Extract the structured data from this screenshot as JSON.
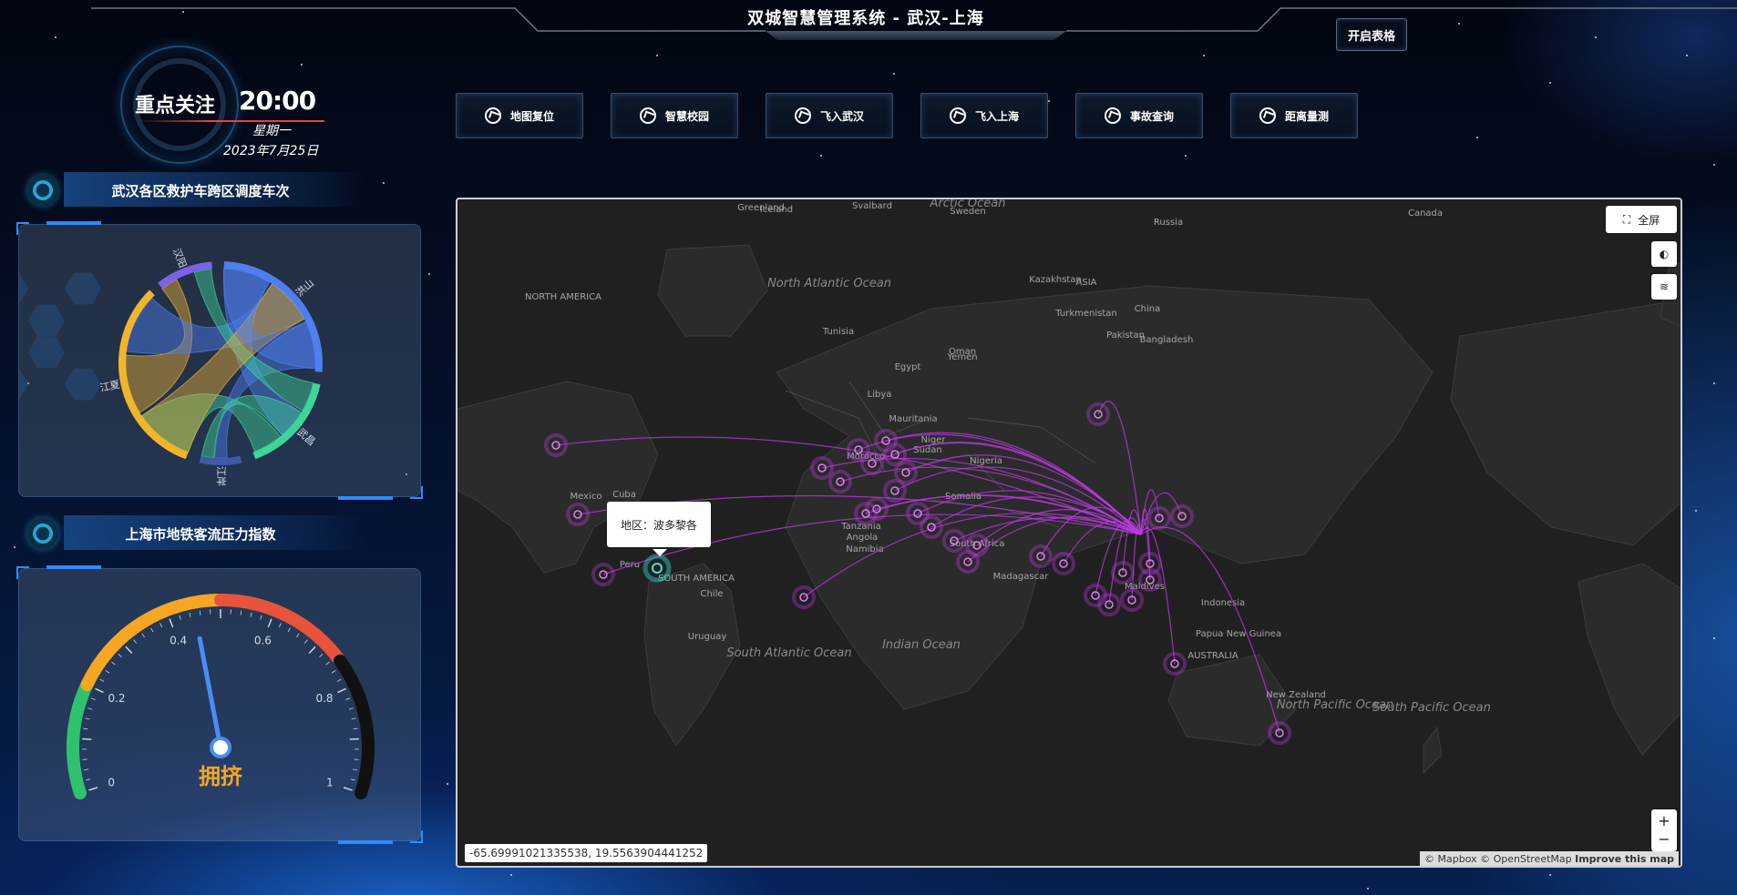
{
  "header": {
    "title": "双城智慧管理系统 - 武汉-上海",
    "toggle_table_label": "开启表格"
  },
  "clock": {
    "focus_label": "重点关注",
    "time": "20:00",
    "weekday": "星期一",
    "date": "2023年7月25日"
  },
  "nav": [
    {
      "label": "地图复位",
      "icon": "map-reset-icon"
    },
    {
      "label": "智慧校园",
      "icon": "campus-icon"
    },
    {
      "label": "飞入武汉",
      "icon": "plane-icon"
    },
    {
      "label": "飞入上海",
      "icon": "plane-icon"
    },
    {
      "label": "事故查询",
      "icon": "incident-icon"
    },
    {
      "label": "距离量测",
      "icon": "measure-icon"
    }
  ],
  "chord_section": {
    "title": "武汉各区救护车跨区调度车次",
    "groups": [
      {
        "name": "汉阳",
        "color": "#7a63e8"
      },
      {
        "name": "洪山",
        "color": "#4d7ff0"
      },
      {
        "name": "武昌",
        "color": "#3fd49a"
      },
      {
        "name": "江岸",
        "color": "#3e5aa8"
      },
      {
        "name": "江夏",
        "color": "#f0b62a"
      }
    ]
  },
  "gauge_section": {
    "title": "上海市地铁客流压力指数",
    "value": 0.45,
    "status": "拥挤",
    "ticks": [
      "0",
      "0.2",
      "0.4",
      "0.6",
      "0.8",
      "1"
    ],
    "colors": {
      "low": "#2fc26e",
      "mid": "#f5a623",
      "high": "#e8533c",
      "max": "#111111",
      "pointer": "#4a8cf5"
    }
  },
  "map": {
    "fullscreen_label": "全屏",
    "popup_label": "地区：波多黎各",
    "coords_readout": "-65.69991021335538, 19.5563904441252",
    "attribution": "© Mapbox © OpenStreetMap",
    "improve_label": "Improve this map",
    "zoom_in": "+",
    "zoom_out": "−",
    "place_labels": [
      "Arctic Ocean",
      "Svalbard",
      "Greenland",
      "Iceland",
      "Sweden",
      "Russia",
      "Canada",
      "NORTH AMERICA",
      "North Atlantic Ocean",
      "Kazakhstan",
      "ASIA",
      "China",
      "Turkmenistan",
      "Pakistan",
      "Bangladesh",
      "Oman",
      "Yemen",
      "Egypt",
      "Libya",
      "Morocco",
      "Mauritania",
      "Niger",
      "Sudan",
      "Nigeria",
      "Somalia",
      "Tanzania",
      "Angola",
      "Namibia",
      "South Africa",
      "Madagascar",
      "Maldives",
      "Indonesia",
      "Papua New Guinea",
      "AUSTRALIA",
      "New Zealand",
      "Mexico",
      "Cuba",
      "Colombia",
      "Peru",
      "SOUTH AMERICA",
      "Chile",
      "Uruguay",
      "South Atlantic Ocean",
      "Indian Ocean",
      "North Pacific Ocean",
      "South Pacific Ocean",
      "Tunisia"
    ],
    "hub": "China",
    "accent": "#c23ae8"
  }
}
